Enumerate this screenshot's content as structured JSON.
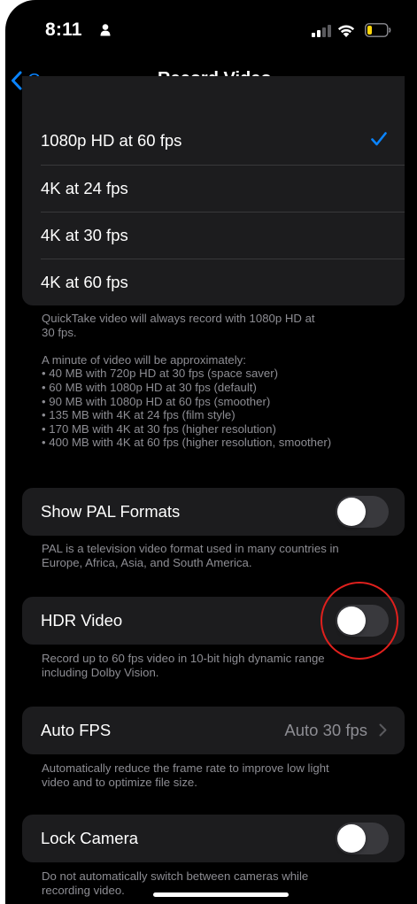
{
  "status_bar": {
    "time": "8:11"
  },
  "nav": {
    "back_label": "Camera",
    "title": "Record Video"
  },
  "resolution_options": [
    {
      "label": "1080p HD at 60 fps",
      "selected": true
    },
    {
      "label": "4K at 24 fps",
      "selected": false
    },
    {
      "label": "4K at 30 fps",
      "selected": false
    },
    {
      "label": "4K at 60 fps",
      "selected": false
    }
  ],
  "resolution_footer": "QuickTake video will always record with 1080p HD at\n30 fps.\n\nA minute of video will be approximately:\n• 40 MB with 720p HD at 30 fps (space saver)\n• 60 MB with 1080p HD at 30 fps (default)\n• 90 MB with 1080p HD at 60 fps (smoother)\n• 135 MB with 4K at 24 fps (film style)\n• 170 MB with 4K at 30 fps (higher resolution)\n• 400 MB with 4K at 60 fps (higher resolution, smoother)",
  "pal": {
    "label": "Show PAL Formats",
    "enabled": false,
    "footer": "PAL is a television video format used in many countries in\nEurope, Africa, Asia, and South America."
  },
  "hdr": {
    "label": "HDR Video",
    "enabled": false,
    "footer": "Record up to 60 fps video in 10-bit high dynamic range\nincluding Dolby Vision."
  },
  "auto_fps": {
    "label": "Auto FPS",
    "value": "Auto 30 fps",
    "footer": "Automatically reduce the frame rate to improve low light\nvideo and to optimize file size."
  },
  "lock_camera": {
    "label": "Lock Camera",
    "enabled": false,
    "footer": "Do not automatically switch between cameras while\nrecording video."
  },
  "colors": {
    "accent": "#0a84ff",
    "group_bg": "#1c1c1e",
    "secondary_text": "#8d8d93",
    "toggle_off": "#39393d",
    "annotation": "#e0201d",
    "battery_low": "#ffd60a"
  }
}
